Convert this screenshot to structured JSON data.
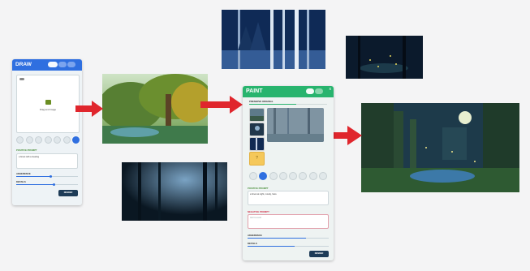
{
  "draw": {
    "title": "DRAW",
    "canvas_placeholder": "Drag and Image",
    "positive_label": "POSITIVE PROMPT",
    "positive_value": "a forest with a clearing",
    "adherence_label": "ADHERENCE",
    "details_label": "DETAILS",
    "render_button": "RENDER",
    "styles": [
      "",
      "",
      "",
      "",
      "",
      "",
      ""
    ]
  },
  "paint": {
    "title": "PAINT",
    "close_glyph": "x",
    "preserve_label": "PRESERVE ORIGINAL",
    "positive_label": "POSITIVE PROMPT",
    "positive_value": "a forest at night, moody, haze",
    "negative_label": "NEGATIVE PROMPT",
    "negative_placeholder": "Add to avoid",
    "adherence_label": "ADHERENCE",
    "details_label": "DETAILS",
    "render_button": "RENDER",
    "thumb_badge": "?"
  },
  "colors": {
    "draw_accent": "#2f6fe0",
    "paint_accent": "#28b46e",
    "arrow_red": "#e0262d",
    "button_dark": "#1d3b57"
  },
  "sliders": {
    "draw_adherence": 0.55,
    "draw_details": 0.6,
    "paint_preserve": 0.6,
    "paint_adherence": 0.72,
    "paint_details": 0.58
  }
}
